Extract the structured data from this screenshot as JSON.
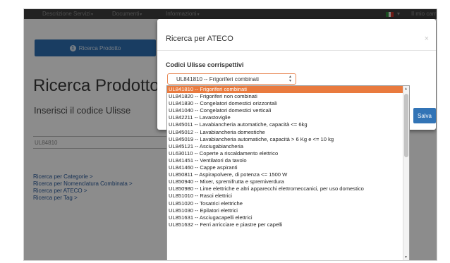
{
  "navbar": {
    "items": [
      {
        "label": "Descrizione Servizi",
        "caret": "▾"
      },
      {
        "label": "Documenti",
        "caret": "▾"
      },
      {
        "label": "Informazioni",
        "caret": "▾"
      }
    ],
    "flag_caret": "▾",
    "user_label": "Il mio carr",
    "flag_colors": [
      "#2f8a3a",
      "#f4f4f4",
      "#c8332b"
    ]
  },
  "page": {
    "step_button": {
      "number": "1",
      "label": "Ricerca Prodotto"
    },
    "title": "Ricerca Prodotto",
    "subtitle": "Inserisci il codice Ulisse",
    "input_value": "UL84810",
    "links": [
      "Ricerca per Categorie >",
      "Ricerca per Nomenclatura Combinata >",
      "Ricerca per ATECO >",
      "Ricerca per Tag >"
    ]
  },
  "modal": {
    "title": "Ricerca per ATECO",
    "close": "×",
    "label": "Codici Ulisse corrispettivi",
    "selected_value": "UL841810 -- Frigoriferi combinati",
    "save_label": "Salva"
  },
  "dropdown": {
    "options": [
      "UL841810 -- Frigoriferi combinati",
      "UL841820 -- Frigoriferi non combinati",
      "UL841830 -- Congelatori domestici orizzontali",
      "UL841040 -- Congelatori domestici verticali",
      "UL842211 -- Lavastoviglie",
      "UL845011 -- Lavabiancheria automatiche, capacità <= 6kg",
      "UL845012 -- Lavabiancheria domestiche",
      "UL845019 -- Lavabiancheria automatiche, capacità > 6 Kg e <= 10 kg",
      "UL845121 -- Asciugabiancheria",
      "UL630110 -- Coperte a riscaldamento elettrico",
      "UL841451 -- Ventilatori da tavolo",
      "UL841460 -- Cappe aspiranti",
      "UL850811 -- Aspirapolvere, di potenza <= 1500 W",
      "UL850940 -- Mixer, spremifrutta e spremiverdura",
      "UL850980 -- Lime elettriche e altri apparecchi elettromeccanici, per uso domestico",
      "UL851010 -- Rasoi elettrici",
      "UL851020 -- Tosatrici elettriche",
      "UL851030 -- Epilatori elettrici",
      "UL851631 -- Asciugacapelli elettrici",
      "UL851632 -- Ferri arricciare e piastre per capelli"
    ],
    "selected_index": 0,
    "scroll_up": "▲",
    "scroll_down": "▼"
  }
}
